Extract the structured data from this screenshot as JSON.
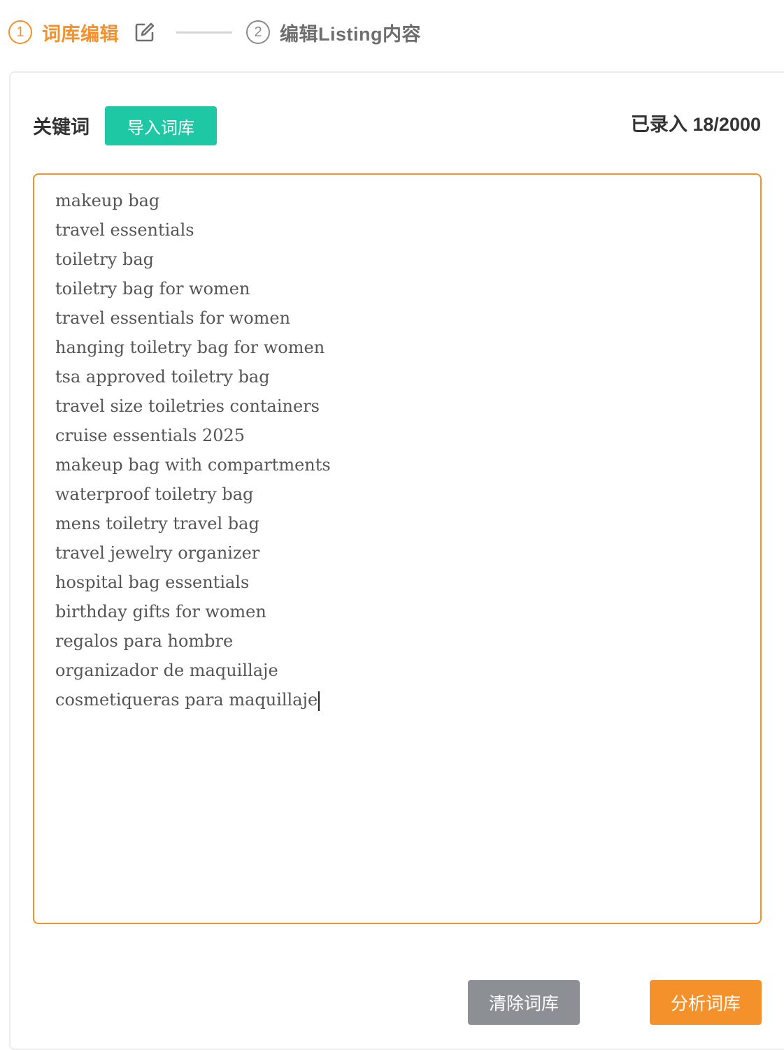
{
  "stepper": {
    "step1": {
      "number": "1",
      "label": "词库编辑"
    },
    "step2": {
      "number": "2",
      "label": "编辑Listing内容"
    }
  },
  "header": {
    "keywords_label": "关键词",
    "import_button": "导入词库",
    "count_label": "已录入 18/2000"
  },
  "keywords": [
    "makeup bag",
    "travel essentials",
    "toiletry bag",
    "toiletry bag for women",
    "travel essentials for women",
    "hanging toiletry bag for women",
    "tsa approved toiletry bag",
    "travel size toiletries containers",
    "cruise essentials 2025",
    "makeup bag with compartments",
    "waterproof toiletry bag",
    "mens toiletry travel bag",
    "travel jewelry organizer",
    "hospital bag essentials",
    "birthday gifts for women",
    "regalos para hombre",
    "organizador de maquillaje",
    "cosmetiqueras para maquillaje"
  ],
  "footer": {
    "clear_button": "清除词库",
    "analyze_button": "分析词库"
  },
  "colors": {
    "accent": "#f5912b",
    "import": "#1ec8a5",
    "clear": "#8c8f94"
  }
}
